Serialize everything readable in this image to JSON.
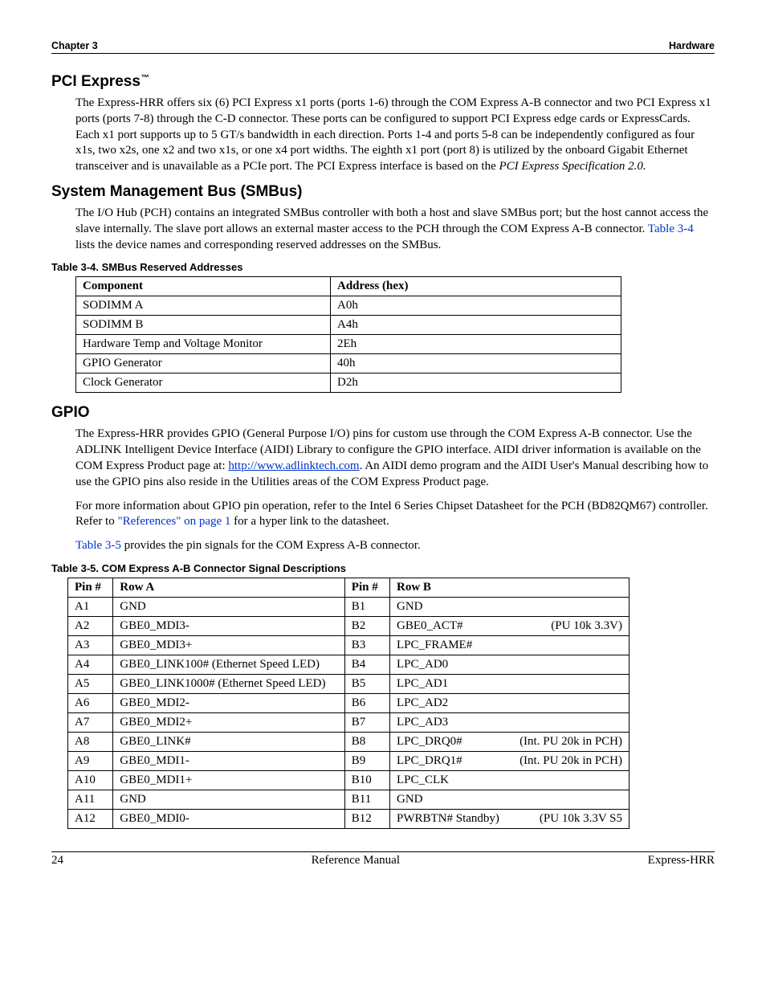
{
  "header": {
    "left": "Chapter 3",
    "right": "Hardware"
  },
  "sec1": {
    "title": "PCI Express",
    "tm": "™",
    "p1": "The Express-HRR offers six (6) PCI Express x1 ports (ports 1-6) through the COM  Express A-B connector and two PCI Express x1 ports (ports 7-8) through the C-D connector. These ports can be configured to support PCI Express edge cards or ExpressCards. Each x1 port supports up to 5 GT/s bandwidth in each direction. Ports 1-4 and ports 5-8 can be independently configured as four x1s, two x2s, one x2 and two x1s, or one x4 port widths. The eighth x1 port (port 8) is utilized by the onboard Gigabit Ethernet transceiver and is unavailable as a PCIe port. The PCI Express interface is based on the ",
    "p1_ital": "PCI Express Specification 2.0."
  },
  "sec2": {
    "title": "System Management Bus (SMBus)",
    "p1a": "The I/O Hub (PCH) contains an integrated SMBus controller with both a host and slave SMBus port; but the host cannot access the slave internally. The slave port allows an external master access to the PCH through the COM Express A-B connector. ",
    "p1_link": "Table 3-4",
    "p1b": " lists the device names and corresponding reserved addresses on the SMBus."
  },
  "t34": {
    "caption": "Table 3-4.   SMBus Reserved Addresses",
    "headers": [
      "Component",
      "Address (hex)"
    ],
    "rows": [
      [
        "SODIMM A",
        "A0h"
      ],
      [
        "SODIMM B",
        "A4h"
      ],
      [
        "Hardware Temp and Voltage Monitor",
        "2Eh"
      ],
      [
        "GPIO Generator",
        "40h"
      ],
      [
        "Clock Generator",
        "D2h"
      ]
    ]
  },
  "sec3": {
    "title": "GPIO",
    "p1a": "The Express-HRR provides GPIO (General Purpose I/O) pins for custom use through the COM Express A-B connector. Use the ADLINK Intelligent Device Interface (AIDI) Library to configure the GPIO interface. AIDI driver information is available on the COM Express Product page at: ",
    "p1_link": "http://www.adlinktech.com",
    "p1b": ". An AIDI demo program and the AIDI User's Manual describing how to use the GPIO pins also reside in the Utilities areas of the COM Express Product page.",
    "p2a": "For more information about GPIO pin operation, refer to the Intel 6 Series Chipset Datasheet for the PCH (BD82QM67) controller. Refer to ",
    "p2_link": "\"References\" on page 1",
    "p2b": " for a hyper link to the datasheet.",
    "p3_link": "Table 3-5",
    "p3b": " provides the pin signals for the COM Express A-B connector."
  },
  "t35": {
    "caption": "Table 3-5.   COM Express A-B Connector Signal Descriptions",
    "headers": [
      "Pin #",
      "Row A",
      "Pin #",
      "Row B"
    ],
    "rows": [
      {
        "aPin": "A1",
        "aSig": "GND",
        "bPin": "B1",
        "bSig": "GND",
        "bNote": ""
      },
      {
        "aPin": "A2",
        "aSig": "GBE0_MDI3-",
        "bPin": "B2",
        "bSig": "GBE0_ACT#",
        "bNote": "(PU 10k 3.3V)"
      },
      {
        "aPin": "A3",
        "aSig": "GBE0_MDI3+",
        "bPin": "B3",
        "bSig": "LPC_FRAME#",
        "bNote": ""
      },
      {
        "aPin": "A4",
        "aSig": "GBE0_LINK100#   (Ethernet Speed LED)",
        "bPin": "B4",
        "bSig": "LPC_AD0",
        "bNote": ""
      },
      {
        "aPin": "A5",
        "aSig": "GBE0_LINK1000# (Ethernet Speed LED)",
        "bPin": "B5",
        "bSig": "LPC_AD1",
        "bNote": ""
      },
      {
        "aPin": "A6",
        "aSig": "GBE0_MDI2-",
        "bPin": "B6",
        "bSig": "LPC_AD2",
        "bNote": ""
      },
      {
        "aPin": "A7",
        "aSig": "GBE0_MDI2+",
        "bPin": "B7",
        "bSig": "LPC_AD3",
        "bNote": ""
      },
      {
        "aPin": "A8",
        "aSig": "GBE0_LINK#",
        "bPin": "B8",
        "bSig": "LPC_DRQ0#",
        "bNote": "(Int. PU 20k in PCH)"
      },
      {
        "aPin": "A9",
        "aSig": "GBE0_MDI1-",
        "bPin": "B9",
        "bSig": "LPC_DRQ1#",
        "bNote": "(Int. PU 20k in PCH)"
      },
      {
        "aPin": "A10",
        "aSig": "GBE0_MDI1+",
        "bPin": "B10",
        "bSig": "LPC_CLK",
        "bNote": ""
      },
      {
        "aPin": "A11",
        "aSig": "GND",
        "bPin": "B11",
        "bSig": "GND",
        "bNote": ""
      },
      {
        "aPin": "A12",
        "aSig": "GBE0_MDI0-",
        "bPin": "B12",
        "bSig": "PWRBTN# Standby)",
        "bNote": "(PU 10k 3.3V S5"
      }
    ]
  },
  "footer": {
    "left": "24",
    "center": "Reference Manual",
    "right": "Express-HRR"
  }
}
